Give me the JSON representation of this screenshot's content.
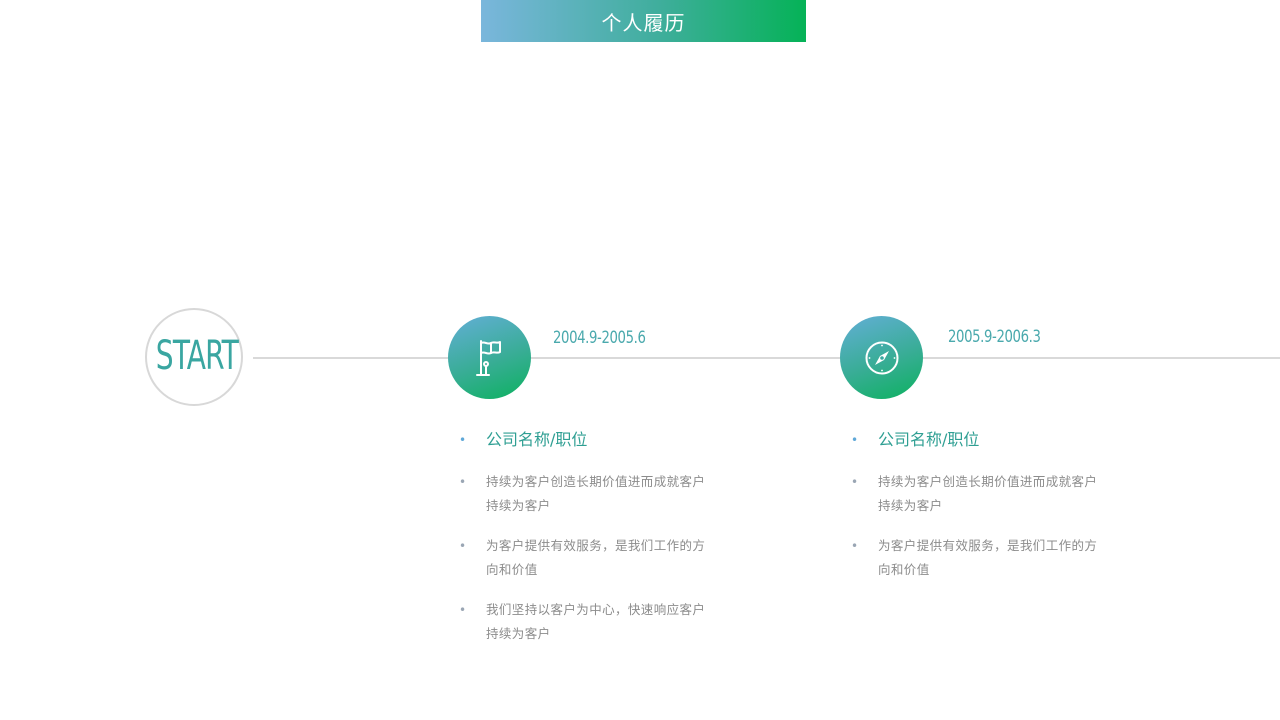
{
  "title": "个人履历",
  "start_label": "START",
  "entries": [
    {
      "date": "2004.9-2005.6",
      "icon": "flag-icon",
      "heading": "公司名称/职位",
      "points": [
        "持续为客户创造长期价值进而成就客户持续为客户",
        "为客户提供有效服务，是我们工作的方向和价值",
        "我们坚持以客户为中心，快速响应客户持续为客户"
      ]
    },
    {
      "date": "2005.9-2006.3",
      "icon": "compass-icon",
      "heading": "公司名称/职位",
      "points": [
        "持续为客户创造长期价值进而成就客户持续为客户",
        "为客户提供有效服务，是我们工作的方向和价值"
      ]
    }
  ],
  "colors": {
    "accent_teal": "#3aa6a1",
    "accent_green": "#05b257",
    "accent_blue": "#7ab6dc",
    "line_gray": "#d9d9d9",
    "body_text": "#8c8c8c"
  }
}
